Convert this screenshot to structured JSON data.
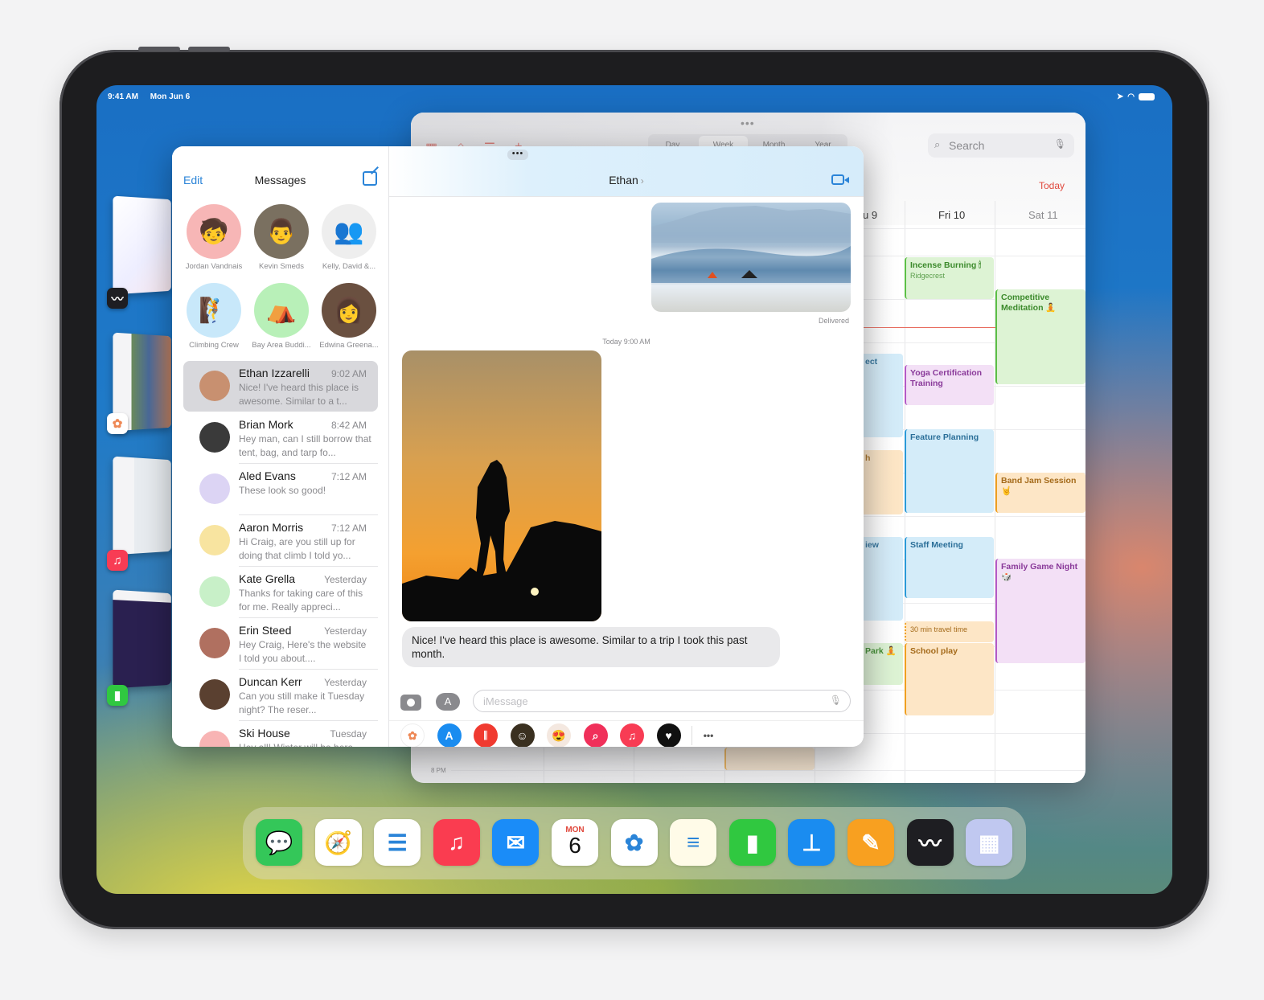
{
  "status_bar": {
    "time": "9:41 AM",
    "date": "Mon Jun 6",
    "icons": [
      "location-icon",
      "wifi-icon",
      "battery-icon"
    ]
  },
  "stage_manager": {
    "apps": [
      {
        "name": "Procreate",
        "icon": "procreate-icon"
      },
      {
        "name": "Photos",
        "icon": "photos-icon"
      },
      {
        "name": "Music",
        "icon": "music-icon"
      },
      {
        "name": "Numbers",
        "icon": "numbers-icon"
      }
    ]
  },
  "calendar": {
    "segments": [
      "Day",
      "Week",
      "Month",
      "Year"
    ],
    "active_segment": "Week",
    "search_placeholder": "Search",
    "today_label": "Today",
    "days": [
      "Thu 9",
      "Fri 10",
      "Sat 11"
    ],
    "time_label": "8 PM",
    "events": [
      {
        "title": "Incense Burning 🕯",
        "subtitle": "Ridgecrest",
        "day": "Fri 10",
        "color": "green"
      },
      {
        "title": "Competitive Meditation 🧘",
        "day": "Sat 11",
        "color": "green"
      },
      {
        "title": "Yoga Certification Training",
        "day": "Fri 10",
        "color": "purple"
      },
      {
        "title": "Feature Planning",
        "day": "Fri 10",
        "color": "blue"
      },
      {
        "title": "Band Jam Session 🤘",
        "day": "Sat 11",
        "color": "orange"
      },
      {
        "title": "Staff Meeting",
        "day": "Fri 10",
        "color": "blue"
      },
      {
        "title": "Family Game Night 🎲",
        "day": "Sat 11",
        "color": "purple"
      },
      {
        "title": "30 min travel time",
        "day": "Fri 10",
        "color": "orange"
      },
      {
        "title": "School play",
        "day": "Fri 10",
        "color": "orange"
      },
      {
        "title": "…ect",
        "day": "Thu 9",
        "color": "blue"
      },
      {
        "title": "…h",
        "day": "Thu 9",
        "color": "orange"
      },
      {
        "title": "…iew",
        "day": "Thu 9",
        "color": "blue"
      },
      {
        "title": "… Park 🧘",
        "day": "Thu 9",
        "color": "green"
      }
    ]
  },
  "messages": {
    "edit_label": "Edit",
    "title": "Messages",
    "pinned": [
      {
        "name": "Jordan Vandnais",
        "emoji": "🧒",
        "bg": "#f7b6b6"
      },
      {
        "name": "Kevin Smeds",
        "emoji": "👨",
        "bg": "#7a7060"
      },
      {
        "name": "Kelly, David &...",
        "emoji": "👥",
        "bg": "#eeeeee"
      },
      {
        "name": "Climbing Crew",
        "emoji": "🧗",
        "bg": "#c8e8fa"
      },
      {
        "name": "Bay Area Buddi...",
        "emoji": "⛺",
        "bg": "#b8f0b8"
      },
      {
        "name": "Edwina Greena...",
        "emoji": "👩",
        "bg": "#6a5040"
      }
    ],
    "conversations": [
      {
        "name": "Ethan Izzarelli",
        "time": "9:02 AM",
        "preview": "Nice! I've heard this place is awesome. Similar to a t...",
        "selected": true,
        "avatar": "#c89070"
      },
      {
        "name": "Brian Mork",
        "time": "8:42 AM",
        "preview": "Hey man, can I still borrow that tent, bag, and tarp fo...",
        "avatar": "#3a3a3a"
      },
      {
        "name": "Aled Evans",
        "time": "7:12 AM",
        "preview": "These look so good!",
        "avatar": "#dcd4f4"
      },
      {
        "name": "Aaron Morris",
        "time": "7:12 AM",
        "preview": "Hi Craig, are you still up for doing that climb I told yo...",
        "avatar": "#f8e4a0"
      },
      {
        "name": "Kate Grella",
        "time": "Yesterday",
        "preview": "Thanks for taking care of this for me. Really appreci...",
        "avatar": "#c8f0c8"
      },
      {
        "name": "Erin Steed",
        "time": "Yesterday",
        "preview": "Hey Craig, Here's the website I told you about....",
        "avatar": "#b07060"
      },
      {
        "name": "Duncan Kerr",
        "time": "Yesterday",
        "preview": "Can you still make it Tuesday night? The reser...",
        "avatar": "#5a4030"
      },
      {
        "name": "Ski House",
        "time": "Tuesday",
        "preview": "Hey all! Winter will be here...",
        "avatar": "#f8b4b4"
      }
    ],
    "chat": {
      "contact": "Ethan",
      "delivered": "Delivered",
      "timestamp": "Today 9:00 AM",
      "bubble_text": "Nice! I've heard this place is awesome. Similar to a trip I took this past month.",
      "input_placeholder": "iMessage"
    },
    "app_strip": [
      {
        "name": "photos-app",
        "bg": "#ffffff",
        "glyph": "✿"
      },
      {
        "name": "app-store-app",
        "bg": "#1a8cf0",
        "glyph": "A"
      },
      {
        "name": "audio-message-app",
        "bg": "#f03a30",
        "glyph": "𝄃"
      },
      {
        "name": "memoji-app",
        "bg": "#3a3020",
        "glyph": "☺"
      },
      {
        "name": "memoji-stickers-app",
        "bg": "#f4e8e0",
        "glyph": "😍"
      },
      {
        "name": "images-search-app",
        "bg": "#f0305a",
        "glyph": "⌕"
      },
      {
        "name": "music-app",
        "bg": "#f83c54",
        "glyph": "♫"
      },
      {
        "name": "digital-touch-app",
        "bg": "#111111",
        "glyph": "♥"
      }
    ],
    "more_label": "•••"
  },
  "dock": {
    "apps": [
      {
        "name": "Messages",
        "bg": "#34c759",
        "glyph": "💬"
      },
      {
        "name": "Safari",
        "bg": "#ffffff",
        "glyph": "🧭"
      },
      {
        "name": "Reminders",
        "bg": "#ffffff",
        "glyph": "☰"
      },
      {
        "name": "Music",
        "bg": "#fa3c50",
        "glyph": "♫"
      },
      {
        "name": "Mail",
        "bg": "#1a8cf8",
        "glyph": "✉"
      },
      {
        "name": "Calendar",
        "bg": "#ffffff",
        "glyph": "6",
        "day_label": "MON",
        "day_number": "6"
      },
      {
        "name": "Photos",
        "bg": "#ffffff",
        "glyph": "✿"
      },
      {
        "name": "Notes",
        "bg": "#fffbe8",
        "glyph": "≡"
      },
      {
        "name": "Numbers",
        "bg": "#30c840",
        "glyph": "▮"
      },
      {
        "name": "Keynote",
        "bg": "#1a8cf0",
        "glyph": "⊥"
      },
      {
        "name": "Pages",
        "bg": "#f8a020",
        "glyph": "✎"
      },
      {
        "name": "Procreate",
        "bg": "#1e1e22",
        "glyph": "〰"
      },
      {
        "name": "App Library",
        "bg": "#c0c8f0",
        "glyph": "▦"
      }
    ]
  },
  "colors": {
    "accent_blue": "#2a84d8",
    "calendar_red": "#e0483c"
  }
}
